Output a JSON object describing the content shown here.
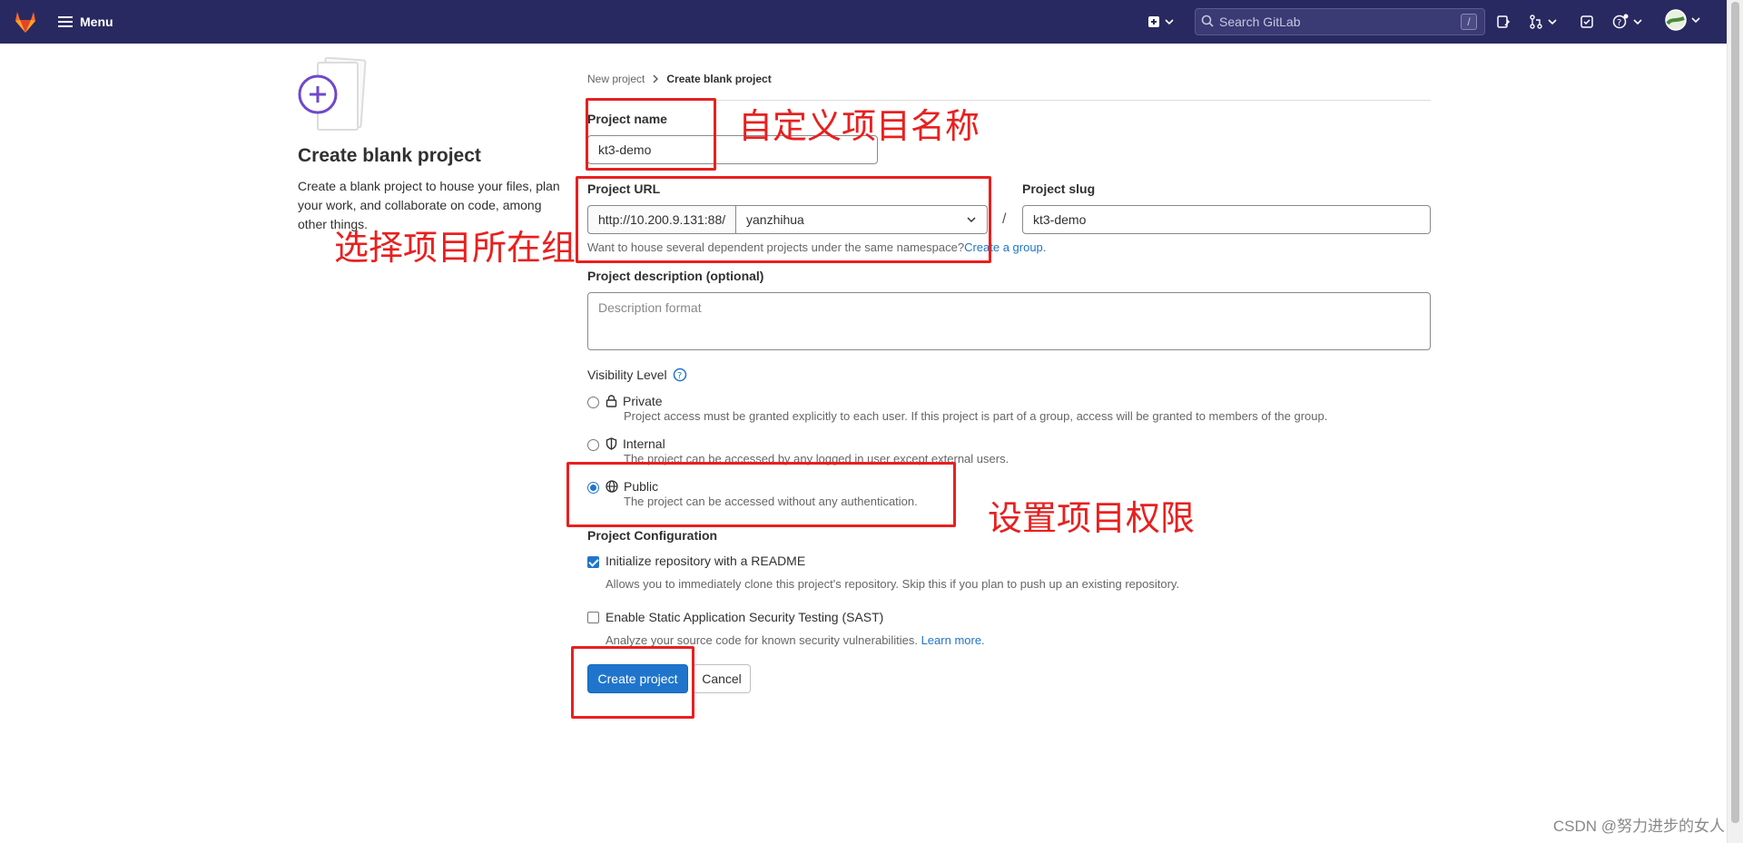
{
  "topbar": {
    "menu_label": "Menu",
    "search_placeholder": "Search GitLab",
    "search_shortcut": "/",
    "icons": [
      "plus-square-icon",
      "chevron-down-icon",
      "search-icon",
      "issues-icon",
      "merge-request-icon",
      "todo-icon",
      "help-icon",
      "avatar"
    ],
    "background": "#292961"
  },
  "left": {
    "title": "Create blank project",
    "description": "Create a blank project to house your files, plan your work, and collaborate on code, among other things."
  },
  "breadcrumb": {
    "parent": "New project",
    "current": "Create blank project"
  },
  "form": {
    "project_name_label": "Project name",
    "project_name_value": "kt3-demo",
    "project_url_label": "Project URL",
    "project_url_prefix": "http://10.200.9.131:88/",
    "namespace_value": "yanzhihua",
    "slug_separator": "/",
    "project_slug_label": "Project slug",
    "project_slug_value": "kt3-demo",
    "namespace_help": "Want to house several dependent projects under the same namespace?",
    "namespace_help_link": "Create a group.",
    "description_label": "Project description (optional)",
    "description_placeholder": "Description format",
    "visibility_label": "Visibility Level",
    "visibility_options": [
      {
        "label": "Private",
        "description": "Project access must be granted explicitly to each user. If this project is part of a group, access will be granted to members of the group.",
        "icon": "lock-icon",
        "selected": false
      },
      {
        "label": "Internal",
        "description": "The project can be accessed by any logged in user except external users.",
        "icon": "shield-icon",
        "selected": false
      },
      {
        "label": "Public",
        "description": "The project can be accessed without any authentication.",
        "icon": "globe-icon",
        "selected": true
      }
    ],
    "config_label": "Project Configuration",
    "readme_label": "Initialize repository with a README",
    "readme_checked": true,
    "readme_help": "Allows you to immediately clone this project's repository. Skip this if you plan to push up an existing repository.",
    "sast_label": "Enable Static Application Security Testing (SAST)",
    "sast_checked": false,
    "sast_help": "Analyze your source code for known security vulnerabilities.",
    "sast_help_link": "Learn more.",
    "create_button": "Create project",
    "cancel_button": "Cancel"
  },
  "annotations": {
    "name": "自定义项目名称",
    "group": "选择项目所在组",
    "visibility": "设置项目权限",
    "color": "#e8201f"
  },
  "watermark": "CSDN @努力进步的女人"
}
